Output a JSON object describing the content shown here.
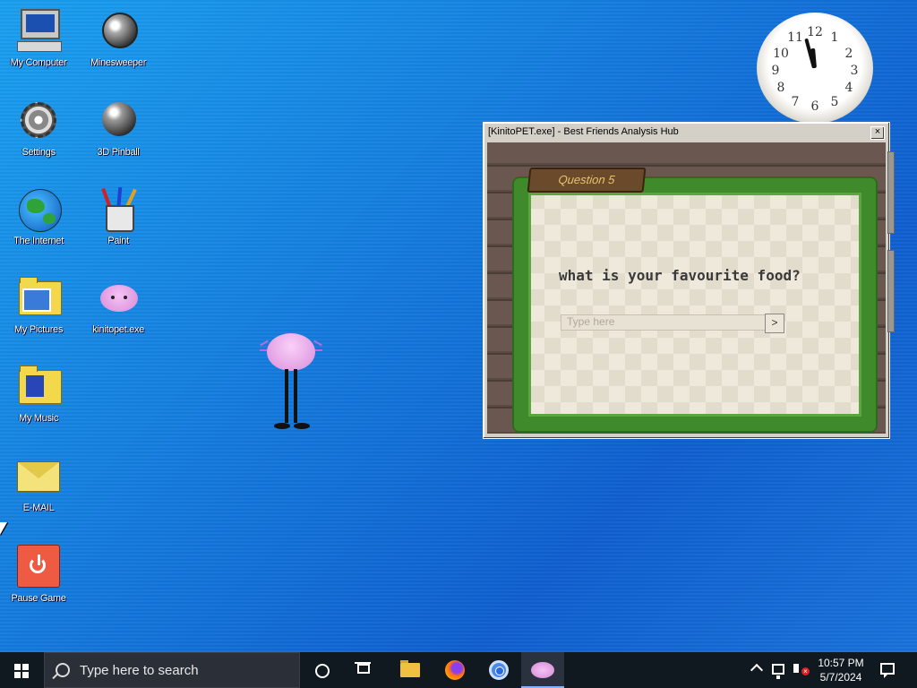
{
  "desktop": {
    "icons": [
      {
        "label": "My Computer",
        "icon": "computer-icon"
      },
      {
        "label": "Minesweeper",
        "icon": "mine-icon"
      },
      {
        "label": "Settings",
        "icon": "gear-icon"
      },
      {
        "label": "3D Pinball",
        "icon": "pinball-icon"
      },
      {
        "label": "The Internet",
        "icon": "globe-icon"
      },
      {
        "label": "Paint",
        "icon": "paint-icon"
      },
      {
        "label": "My Pictures",
        "icon": "pictures-folder-icon"
      },
      {
        "label": "kinitopet.exe",
        "icon": "axolotl-icon"
      },
      {
        "label": "My Music",
        "icon": "music-folder-icon"
      },
      {
        "label": "E-MAIL",
        "icon": "envelope-icon"
      },
      {
        "label": "Pause Game",
        "icon": "power-icon"
      }
    ]
  },
  "clock_widget": {
    "numbers": [
      "12",
      "1",
      "2",
      "3",
      "4",
      "5",
      "6",
      "7",
      "8",
      "9",
      "10",
      "11"
    ]
  },
  "window": {
    "title": "[KinitoPET.exe] - Best Friends Analysis Hub",
    "close_label": "×",
    "question_label": "Question 5",
    "question_text": "what is your favourite food?",
    "answer_placeholder": "Type here",
    "submit_label": ">"
  },
  "taskbar": {
    "search_placeholder": "Type here to search",
    "time": "10:57 PM",
    "date": "5/7/2024",
    "volume_badge": "×"
  }
}
